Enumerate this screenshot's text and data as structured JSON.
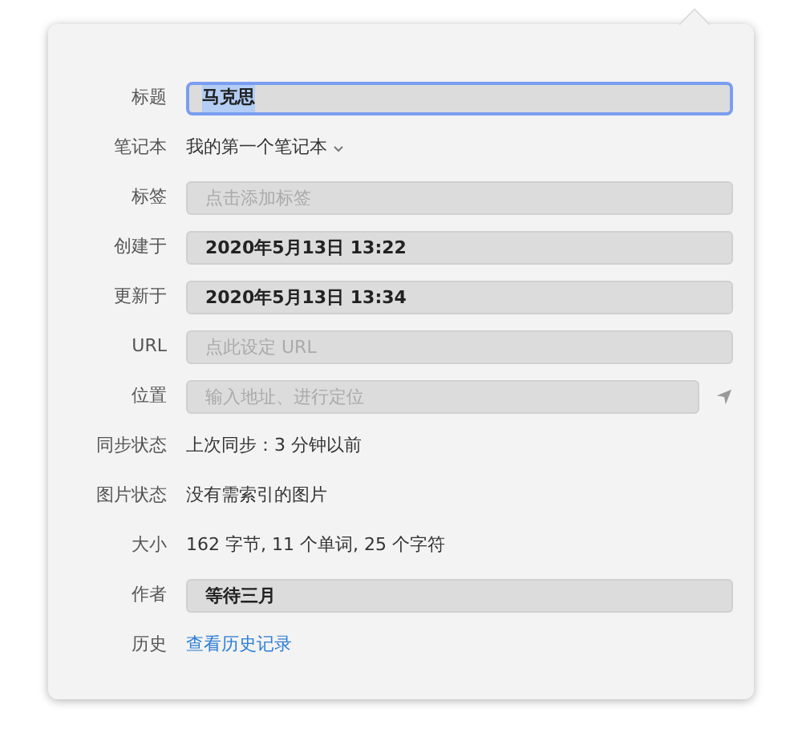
{
  "rows": [
    {
      "label": "标题",
      "kind": "field",
      "value": "马克思",
      "focused": true
    },
    {
      "label": "笔记本",
      "kind": "dropdown",
      "value": "我的第一个笔记本"
    },
    {
      "label": "标签",
      "kind": "field",
      "placeholder": "点击添加标签",
      "focused": false
    },
    {
      "label": "创建于",
      "kind": "field",
      "value": "2020年5月13日 13:22",
      "focused": false
    },
    {
      "label": "更新于",
      "kind": "field",
      "value": "2020年5月13日 13:34",
      "focused": false
    },
    {
      "label": "URL",
      "kind": "field",
      "placeholder": "点此设定 URL",
      "focused": false
    },
    {
      "label": "位置",
      "kind": "location",
      "placeholder": "输入地址、进行定位",
      "focused": false
    },
    {
      "label": "同步状态",
      "kind": "text",
      "value": "上次同步：3 分钟以前"
    },
    {
      "label": "图片状态",
      "kind": "text",
      "value": "没有需索引的图片"
    },
    {
      "label": "大小",
      "kind": "text",
      "value": "162 字节, 11 个单词, 25 个字符"
    },
    {
      "label": "作者",
      "kind": "field",
      "value": "等待三月",
      "focused": false
    },
    {
      "label": "历史",
      "kind": "link",
      "value": "查看历史记录"
    }
  ]
}
